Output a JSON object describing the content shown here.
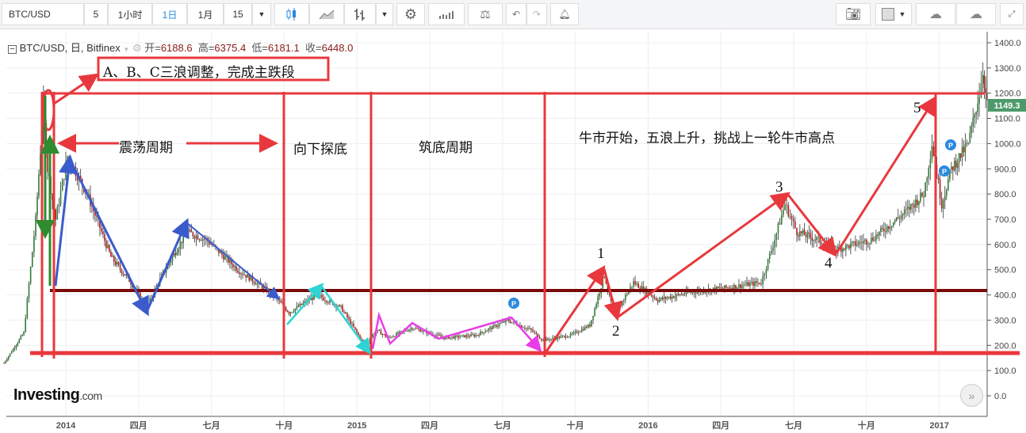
{
  "toolbar": {
    "symbol": "BTC/USD",
    "intervals": [
      "5",
      "1小时",
      "1日",
      "1月",
      "15"
    ],
    "active_interval": "1日"
  },
  "legend": {
    "title": "BTC/USD, 日, Bitfinex",
    "open_label": "开=",
    "open": "6188.6",
    "high_label": "高=",
    "high": "6375.4",
    "low_label": "低=",
    "low": "6181.1",
    "close_label": "收=",
    "close": "6448.0"
  },
  "annotations": {
    "box_title": "A、B、C三浪调整，完成主跌段",
    "phase1": "震荡周期",
    "phase2": "向下探底",
    "phase3": "筑底周期",
    "phase4": "牛市开始，五浪上升，挑战上一轮牛市高点",
    "waves": [
      "1",
      "2",
      "3",
      "4",
      "5"
    ]
  },
  "brand": {
    "name": "Investing",
    "suffix": ".com"
  },
  "colors": {
    "annotation_red": "#e8383d",
    "support_line": "#7a0a0a",
    "price_badge": "#4c9a6a",
    "accent": "#2a8ae0"
  },
  "chart_data": {
    "type": "line",
    "title": "BTC/USD, 日, Bitfinex",
    "x_unit": "months since 2014-01",
    "x_ticks": [
      {
        "m": 0,
        "label": "2014"
      },
      {
        "m": 3,
        "label": "四月"
      },
      {
        "m": 6,
        "label": "七月"
      },
      {
        "m": 9,
        "label": "十月"
      },
      {
        "m": 12,
        "label": "2015"
      },
      {
        "m": 15,
        "label": "四月"
      },
      {
        "m": 18,
        "label": "七月"
      },
      {
        "m": 21,
        "label": "十月"
      },
      {
        "m": 24,
        "label": "2016"
      },
      {
        "m": 27,
        "label": "四月"
      },
      {
        "m": 30,
        "label": "七月"
      },
      {
        "m": 33,
        "label": "十月"
      },
      {
        "m": 36,
        "label": "2017"
      }
    ],
    "y_ticks": [
      "0.0",
      "100.0",
      "200.0",
      "300.0",
      "400.0",
      "500.0",
      "600.0",
      "700.0",
      "800.0",
      "900.0",
      "1000.0",
      "1100.0",
      "1200.0",
      "1300.0",
      "1400.0"
    ],
    "ylim": [
      0,
      1400
    ],
    "last_price": "1149.3",
    "series": [
      {
        "name": "BTC/USD",
        "x": [
          -2.55,
          -1.73,
          -1.24,
          -0.92,
          -0.75,
          -0.42,
          0.07,
          0.88,
          1.86,
          2.68,
          3.33,
          3.82,
          4.97,
          5.78,
          7.09,
          8.56,
          9.2,
          10.36,
          11.34,
          12.32,
          12.8,
          13.3,
          14.28,
          15.59,
          16.9,
          18.2,
          19.18,
          19.67,
          20.8,
          21.6,
          22.2,
          22.6,
          23.4,
          24.4,
          25.7,
          27.35,
          28.66,
          29.15,
          29.64,
          30.13,
          30.95,
          31.76,
          33.2,
          34.5,
          35.36,
          35.7,
          36.1,
          36.5,
          37.2,
          37.65,
          37.8,
          37.97
        ],
        "y": [
          130,
          250,
          700,
          1150,
          900,
          700,
          950,
          800,
          550,
          450,
          350,
          450,
          650,
          620,
          500,
          400,
          330,
          400,
          350,
          200,
          260,
          230,
          270,
          230,
          240,
          300,
          260,
          220,
          240,
          280,
          480,
          320,
          450,
          380,
          410,
          430,
          450,
          600,
          760,
          650,
          620,
          580,
          620,
          720,
          800,
          1000,
          760,
          900,
          1000,
          1200,
          1290,
          1150
        ]
      }
    ],
    "grid": true
  }
}
